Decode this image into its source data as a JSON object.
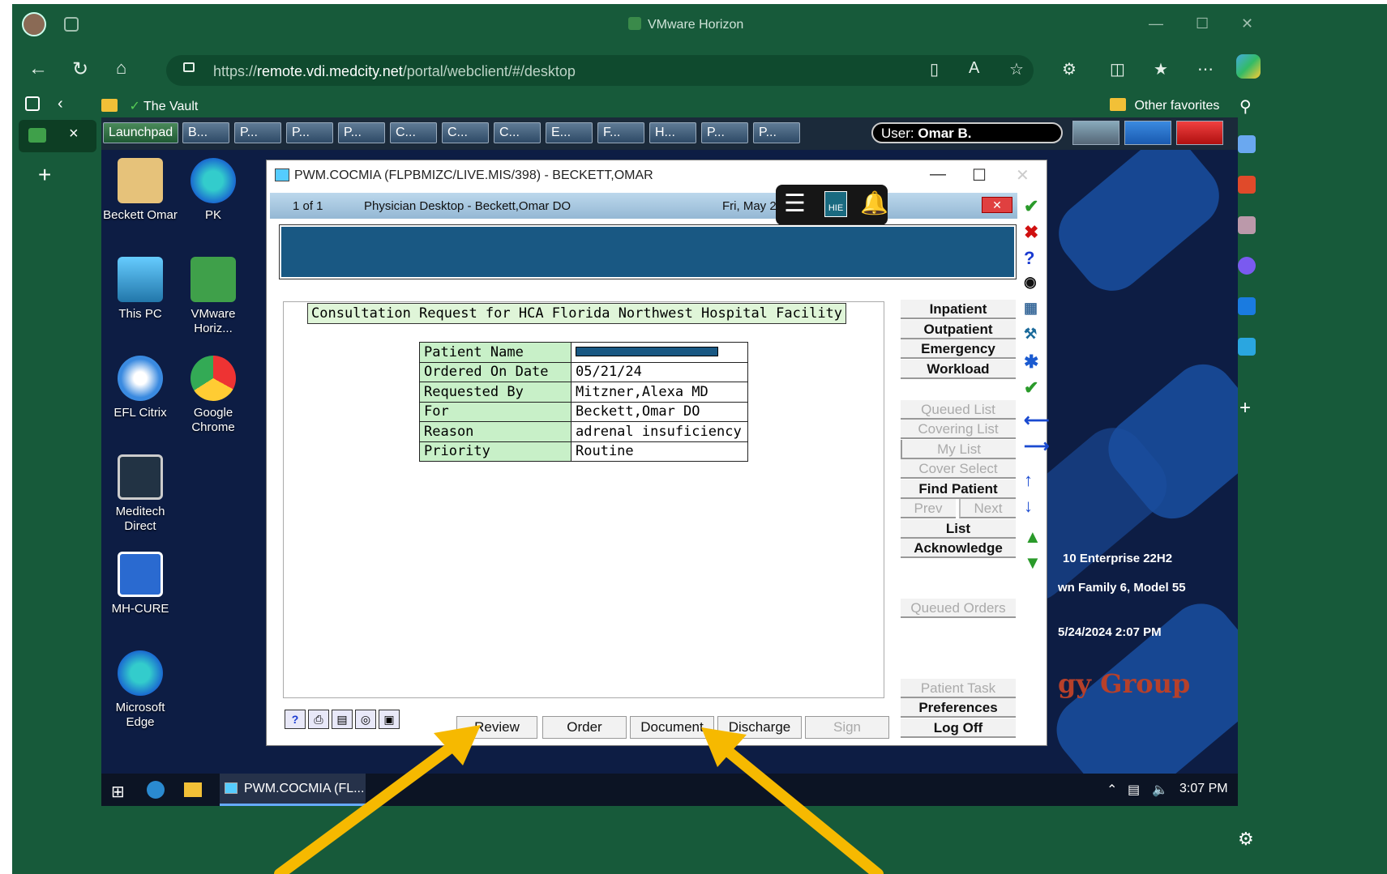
{
  "browser": {
    "window_title": "VMware Horizon",
    "url_prefix": "https://",
    "url_host": "remote.vdi.medcity.net",
    "url_path": "/portal/webclient/#/desktop",
    "fav_vault": "The Vault",
    "fav_other": "Other favorites"
  },
  "launchpad": {
    "launch_label": "Launchpad",
    "tabs": [
      "B...",
      "P...",
      "P...",
      "P...",
      "C...",
      "C...",
      "C...",
      "E...",
      "F...",
      "H...",
      "P...",
      "P..."
    ],
    "user_label": "User:",
    "user_name": "Omar B."
  },
  "desktop": {
    "icons": [
      "Beckett Omar",
      "PK",
      "This PC",
      "VMware Horiz...",
      "EFL Citrix",
      "Google Chrome",
      "Meditech Direct",
      "MH-CURE",
      "Microsoft Edge"
    ],
    "sysinfo": [
      "10 Enterprise 22H2",
      "wn Family 6, Model 55",
      "5/24/2024 2:07 PM"
    ],
    "bg_text": "gy Group"
  },
  "app": {
    "window_title": "PWM.COCMIA (FLPBMIZC/LIVE.MIS/398) - BECKETT,OMAR",
    "page_count": "1 of 1",
    "desk_title": "Physician Desktop - Beckett,Omar  DO",
    "date_text": "Fri, May 2",
    "hie_label": "HIE",
    "consult_title": "Consultation Request for HCA Florida Northwest Hospital Facility",
    "fields": [
      {
        "label": "Patient Name",
        "value": ""
      },
      {
        "label": "Ordered On Date",
        "value": "05/21/24"
      },
      {
        "label": "Requested By",
        "value": "Mitzner,Alexa  MD"
      },
      {
        "label": "For",
        "value": "Beckett,Omar  DO"
      },
      {
        "label": "Reason",
        "value": "adrenal insuficiency"
      },
      {
        "label": "Priority",
        "value": "Routine"
      }
    ],
    "right_buttons": {
      "inpatient": "Inpatient",
      "outpatient": "Outpatient",
      "emergency": "Emergency",
      "workload": "Workload",
      "queued_list": "Queued List",
      "covering_list": "Covering List",
      "my_list": "My List",
      "cover_select": "Cover Select",
      "find_patient": "Find Patient",
      "prev": "Prev",
      "next": "Next",
      "list": "List",
      "acknowledge": "Acknowledge",
      "queued_orders": "Queued Orders",
      "patient_task": "Patient Task",
      "preferences": "Preferences",
      "log_off": "Log Off"
    },
    "bottom_buttons": {
      "review": "Review",
      "order": "Order",
      "document": "Document",
      "discharge": "Discharge",
      "sign": "Sign"
    }
  },
  "taskbar": {
    "app_label": "PWM.COCMIA (FL...",
    "time": "3:07 PM"
  },
  "colors": {
    "frame_green": "#175a3a",
    "desktop_navy": "#0d1d44",
    "band_blue": "#195883",
    "field_green": "#c8f0c8",
    "arrow_yellow": "#f6b900"
  }
}
